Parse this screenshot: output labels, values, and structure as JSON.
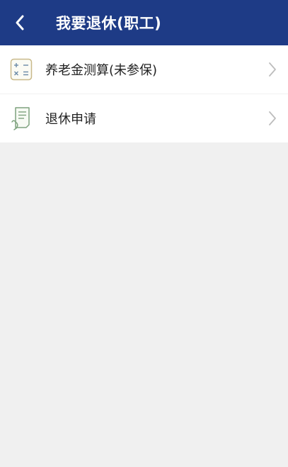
{
  "header": {
    "title": "我要退休(职工)",
    "back_icon": "chevron-left-icon",
    "background": "#1e3b86"
  },
  "menu": {
    "items": [
      {
        "label": "养老金测算(未参保)",
        "icon": "calculator-icon"
      },
      {
        "label": "退休申请",
        "icon": "application-form-icon"
      }
    ],
    "chevron_icon": "chevron-right-icon"
  },
  "colors": {
    "accent": "#1e3b86",
    "background": "#f0f0f0",
    "row_background": "#ffffff",
    "text": "#222222",
    "chevron": "#bdbdbd"
  }
}
